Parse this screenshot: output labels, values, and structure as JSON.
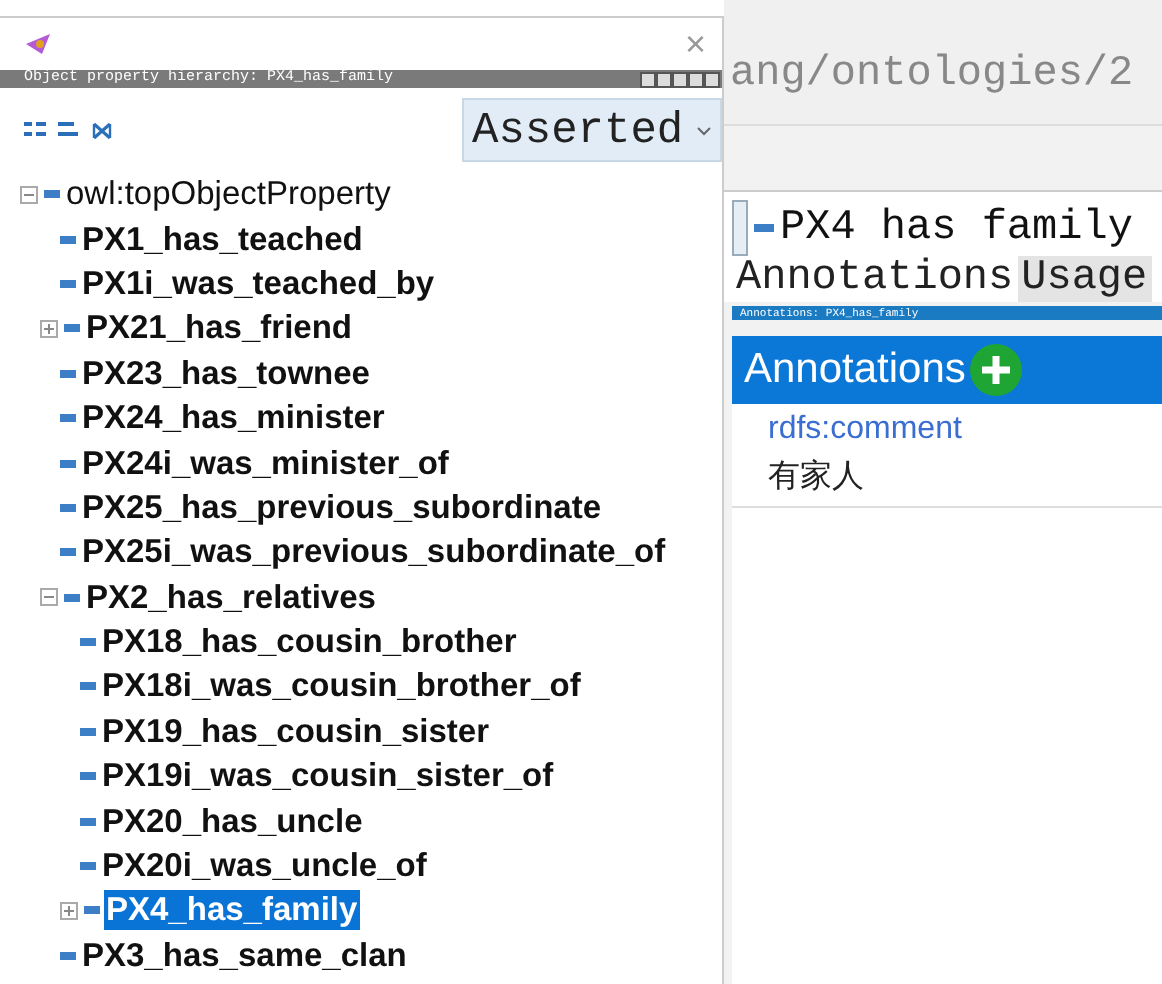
{
  "hierarchy_window": {
    "title_bar_close": "×",
    "header": "Object property hierarchy: PX4_has_family",
    "mode_dropdown": {
      "value": "Asserted"
    },
    "tree": [
      {
        "label": "owl:topObjectProperty",
        "expanded": true,
        "selected": false,
        "children": [
          {
            "label": "PX1_has_teached",
            "selected": false
          },
          {
            "label": "PX1i_was_teached_by",
            "selected": false
          },
          {
            "label": "PX21_has_friend",
            "expanded": false,
            "selected": false
          },
          {
            "label": "PX23_has_townee",
            "selected": false
          },
          {
            "label": "PX24_has_minister",
            "selected": false
          },
          {
            "label": "PX24i_was_minister_of",
            "selected": false
          },
          {
            "label": "PX25_has_previous_subordinate",
            "selected": false
          },
          {
            "label": "PX25i_was_previous_subordinate_of",
            "selected": false
          },
          {
            "label": "PX2_has_relatives",
            "expanded": true,
            "selected": false,
            "children": [
              {
                "label": "PX18_has_cousin_brother",
                "selected": false
              },
              {
                "label": "PX18i_was_cousin_brother_of",
                "selected": false
              },
              {
                "label": "PX19_has_cousin_sister",
                "selected": false
              },
              {
                "label": "PX19i_was_cousin_sister_of",
                "selected": false
              },
              {
                "label": "PX20_has_uncle",
                "selected": false
              },
              {
                "label": "PX20i_was_uncle_of",
                "selected": false
              },
              {
                "label": "PX4_has_family",
                "expanded": false,
                "selected": true
              }
            ]
          },
          {
            "label": "PX3_has_same_clan",
            "selected": false
          }
        ]
      }
    ]
  },
  "main": {
    "url_fragment": "ang/ontologies/2",
    "entity_title": "PX4 has family",
    "tabs": [
      {
        "label": "Annotations",
        "selected": true
      },
      {
        "label": "Usage",
        "selected": false
      }
    ],
    "view_header": "Annotations: PX4_has_family",
    "annotations_header": "Annotations",
    "annotations": [
      {
        "property": "rdfs:comment",
        "value": "有家人"
      }
    ]
  }
}
